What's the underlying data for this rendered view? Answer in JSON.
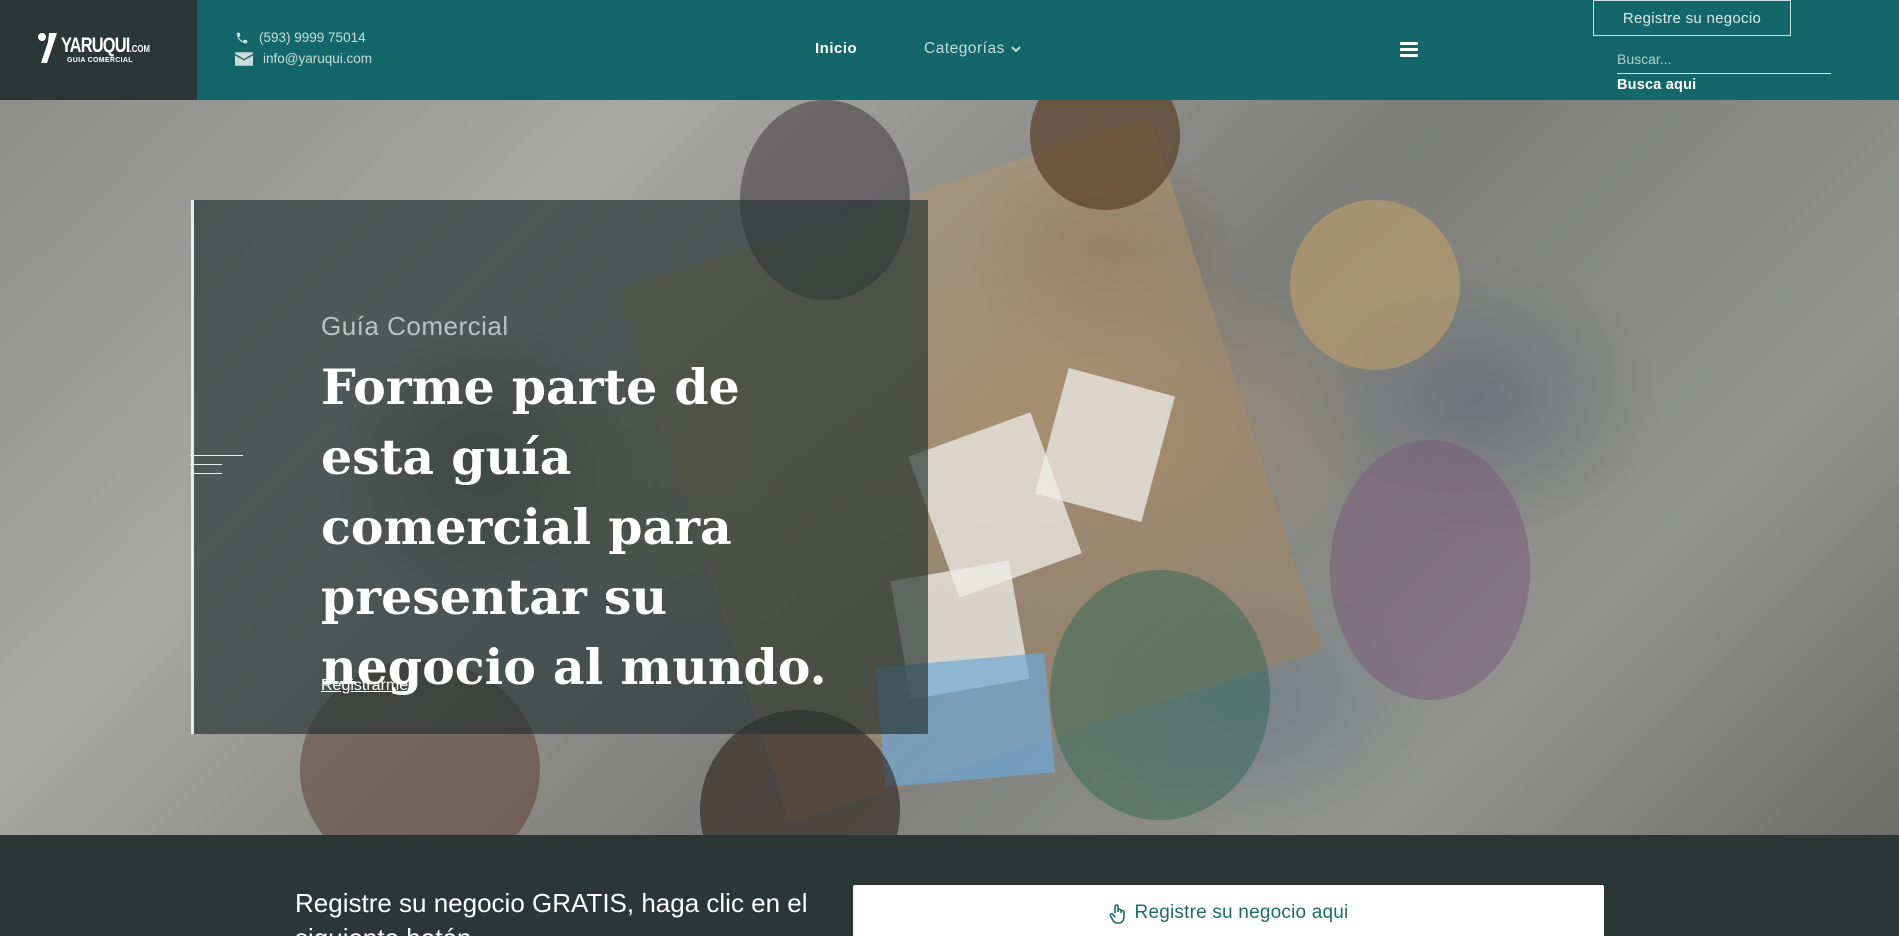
{
  "brand": {
    "name": "YARUQUI",
    "domain_suffix": ".COM",
    "tagline": "GUIA COMERCIAL"
  },
  "contact": {
    "phone": "(593) 9999 75014",
    "email": "info@yaruqui.com"
  },
  "nav": {
    "home": "Inicio",
    "categories": "Categorías"
  },
  "header_actions": {
    "register_button": "Registre su negocio",
    "search_placeholder": "Buscar...",
    "search_hint": "Busca aqui"
  },
  "hero": {
    "subtitle": "Guía Comercial",
    "title": "Forme parte de esta guía comercial para presentar su negocio al mundo.",
    "link": "Registrarme"
  },
  "band": {
    "text": "Registre su negocio GRATIS, haga clic en el siguiente botón",
    "button": "Registre su negocio aqui"
  },
  "colors": {
    "header_bg": "#13676a",
    "dark_bg": "#2b3734",
    "accent_text": "#1e6b6d"
  },
  "icons": {
    "phone": "phone-icon",
    "mail": "envelope-icon",
    "dropdown": "chevron-down-icon",
    "menu": "hamburger-menu-icon",
    "button": "hand-pointer-icon"
  }
}
